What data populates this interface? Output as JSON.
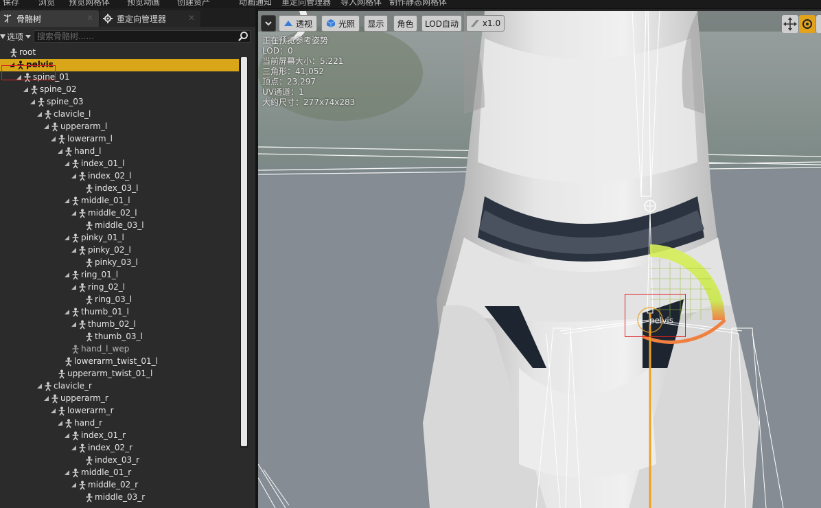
{
  "top_menu": [
    "保存",
    "浏览",
    "预览网格体",
    "预览动画",
    "创建资产",
    "动画通知",
    "重定向管理器",
    "导入网格体",
    "制作静态网格体"
  ],
  "tabs": [
    {
      "label": "骨骼树",
      "active": true
    },
    {
      "label": "重定向管理器",
      "active": false
    }
  ],
  "options_label": "选项",
  "search_placeholder": "搜索骨骼树......",
  "bones": [
    {
      "name": "root",
      "depth": 0,
      "expander": false,
      "selected": false
    },
    {
      "name": "pelvis",
      "depth": 1,
      "expander": true,
      "selected": true
    },
    {
      "name": "spine_01",
      "depth": 2,
      "expander": true,
      "selected": false
    },
    {
      "name": "spine_02",
      "depth": 3,
      "expander": true,
      "selected": false
    },
    {
      "name": "spine_03",
      "depth": 4,
      "expander": true,
      "selected": false
    },
    {
      "name": "clavicle_l",
      "depth": 5,
      "expander": true,
      "selected": false
    },
    {
      "name": "upperarm_l",
      "depth": 6,
      "expander": true,
      "selected": false
    },
    {
      "name": "lowerarm_l",
      "depth": 7,
      "expander": true,
      "selected": false
    },
    {
      "name": "hand_l",
      "depth": 8,
      "expander": true,
      "selected": false
    },
    {
      "name": "index_01_l",
      "depth": 9,
      "expander": true,
      "selected": false
    },
    {
      "name": "index_02_l",
      "depth": 10,
      "expander": true,
      "selected": false
    },
    {
      "name": "index_03_l",
      "depth": 11,
      "expander": false,
      "selected": false
    },
    {
      "name": "middle_01_l",
      "depth": 9,
      "expander": true,
      "selected": false
    },
    {
      "name": "middle_02_l",
      "depth": 10,
      "expander": true,
      "selected": false
    },
    {
      "name": "middle_03_l",
      "depth": 11,
      "expander": false,
      "selected": false
    },
    {
      "name": "pinky_01_l",
      "depth": 9,
      "expander": true,
      "selected": false
    },
    {
      "name": "pinky_02_l",
      "depth": 10,
      "expander": true,
      "selected": false
    },
    {
      "name": "pinky_03_l",
      "depth": 11,
      "expander": false,
      "selected": false
    },
    {
      "name": "ring_01_l",
      "depth": 9,
      "expander": true,
      "selected": false
    },
    {
      "name": "ring_02_l",
      "depth": 10,
      "expander": true,
      "selected": false
    },
    {
      "name": "ring_03_l",
      "depth": 11,
      "expander": false,
      "selected": false
    },
    {
      "name": "thumb_01_l",
      "depth": 9,
      "expander": true,
      "selected": false
    },
    {
      "name": "thumb_02_l",
      "depth": 10,
      "expander": true,
      "selected": false
    },
    {
      "name": "thumb_03_l",
      "depth": 11,
      "expander": false,
      "selected": false
    },
    {
      "name": "hand_l_wep",
      "depth": 9,
      "expander": false,
      "selected": false,
      "dim": true
    },
    {
      "name": "lowerarm_twist_01_l",
      "depth": 8,
      "expander": false,
      "selected": false
    },
    {
      "name": "upperarm_twist_01_l",
      "depth": 7,
      "expander": false,
      "selected": false
    },
    {
      "name": "clavicle_r",
      "depth": 5,
      "expander": true,
      "selected": false
    },
    {
      "name": "upperarm_r",
      "depth": 6,
      "expander": true,
      "selected": false
    },
    {
      "name": "lowerarm_r",
      "depth": 7,
      "expander": true,
      "selected": false
    },
    {
      "name": "hand_r",
      "depth": 8,
      "expander": true,
      "selected": false
    },
    {
      "name": "index_01_r",
      "depth": 9,
      "expander": true,
      "selected": false
    },
    {
      "name": "index_02_r",
      "depth": 10,
      "expander": true,
      "selected": false
    },
    {
      "name": "index_03_r",
      "depth": 11,
      "expander": false,
      "selected": false
    },
    {
      "name": "middle_01_r",
      "depth": 9,
      "expander": true,
      "selected": false
    },
    {
      "name": "middle_02_r",
      "depth": 10,
      "expander": true,
      "selected": false
    },
    {
      "name": "middle_03_r",
      "depth": 11,
      "expander": false,
      "selected": false
    }
  ],
  "viewport": {
    "toolbar": {
      "perspective": "透视",
      "lighting": "光照",
      "show": "显示",
      "character": "角色",
      "lod": "LOD自动",
      "speed": "x1.0"
    },
    "stats": [
      "正在预览参考姿势",
      "LOD：0",
      "当前屏幕大小：5.221",
      "三角形：41,052",
      "顶点：23,297",
      "UV通道：1",
      "大约尺寸：277x74x283"
    ],
    "selected_bone_label": "pelvis"
  },
  "colors": {
    "selection": "#d9a61a",
    "highlight_box": "#e02020",
    "bone_line": "#ffffff",
    "selected_bone": "#f0a020"
  }
}
